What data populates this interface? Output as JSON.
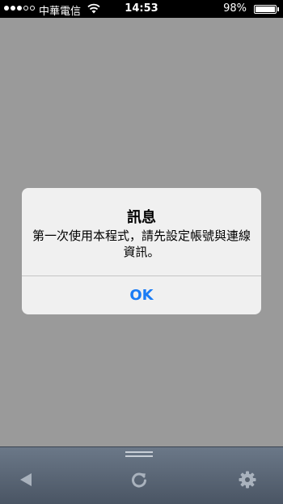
{
  "status_bar": {
    "carrier": "中華電信",
    "time": "14:53",
    "battery_percent": "98%",
    "battery_level": 0.98,
    "signal_bars_filled": 3,
    "signal_bars_total": 5
  },
  "alert": {
    "title": "訊息",
    "message": "第一次使用本程式，請先設定帳號與連線資訊。",
    "ok_label": "OK"
  },
  "toolbar": {
    "icons": [
      "back-icon",
      "refresh-icon",
      "gear-icon"
    ]
  },
  "colors": {
    "accent": "#1a7cf5",
    "background_dim": "#9a9a9a",
    "toolbar": "#56606d"
  }
}
